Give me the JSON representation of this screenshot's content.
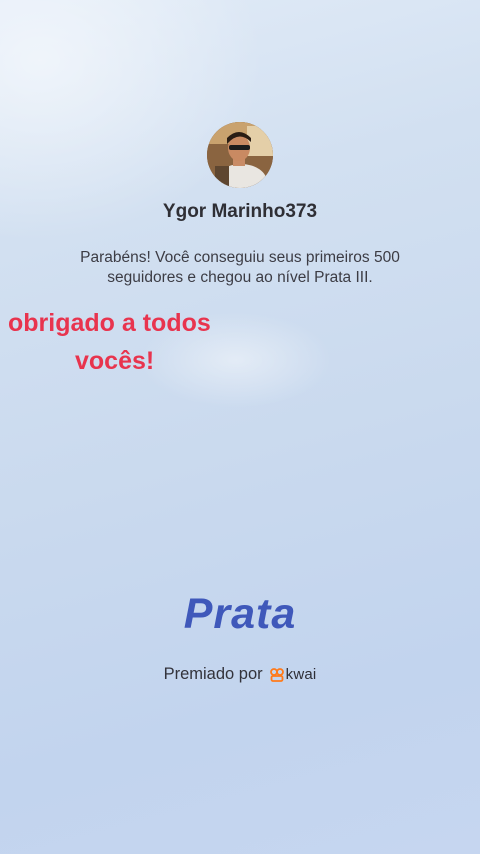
{
  "profile": {
    "avatar_icon": "user-avatar-photo",
    "username": "Ygor Marinho373"
  },
  "achievement": {
    "message": "Parabéns! Você conseguiu seus primeiros 500 seguidores e chegou ao nível Prata III.",
    "level": "Prata",
    "awarded_by_label": "Premiado por",
    "brand": "kwai",
    "brand_icon": "kwai-logo-icon"
  },
  "overlay_text": {
    "line1": "obrigado a todos",
    "line2": "vocês!"
  },
  "colors": {
    "overlay_text": "#e8344e",
    "level_text": "#3f58ba",
    "brand_accent": "#ff7a1a"
  }
}
